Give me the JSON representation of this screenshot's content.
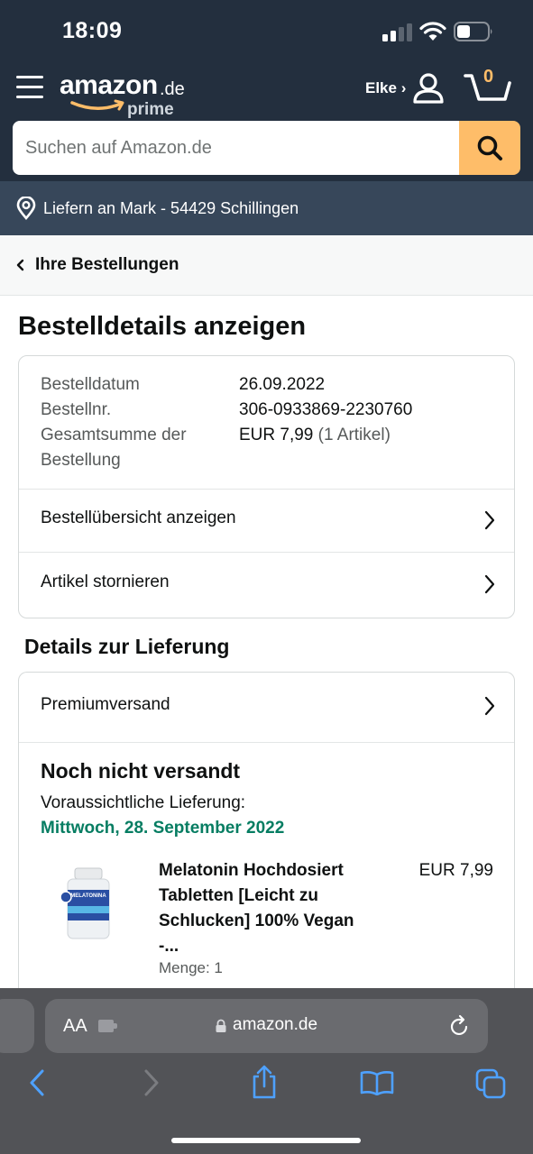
{
  "status_bar": {
    "time": "18:09"
  },
  "header": {
    "logo_word": "amazon",
    "logo_tld": ".de",
    "logo_prime": "prime",
    "account_label": "Elke ›",
    "cart_count": "0",
    "search_placeholder": "Suchen auf Amazon.de",
    "deliver_to": "Liefern an Mark - 54429 Schillingen"
  },
  "breadcrumb": {
    "label": "Ihre Bestellungen"
  },
  "page_title": "Bestelldetails anzeigen",
  "order": {
    "date_label": "Bestelldatum",
    "date_value": "26.09.2022",
    "number_label": "Bestellnr.",
    "number_value": "306-0933869-2230760",
    "total_label_1": "Gesamtsumme der",
    "total_label_2": "Bestellung",
    "total_value": "EUR 7,99",
    "total_items": "(1 Artikel)",
    "summary_link": "Bestellübersicht anzeigen",
    "cancel_link": "Artikel stornieren"
  },
  "delivery": {
    "section_title": "Details zur Lieferung",
    "shipping_method": "Premiumversand",
    "status": "Noch nicht versandt",
    "eta_label": "Voraussichtliche Lieferung:",
    "eta_date": "Mittwoch, 28. September 2022",
    "item": {
      "title_lines": [
        "Melatonin Hochdosiert",
        "Tabletten [Leicht zu",
        "Schlucken] 100% Vegan",
        "-..."
      ],
      "price": "EUR 7,99",
      "quantity": "Menge: 1",
      "image_label": "MELATONINA"
    }
  },
  "browser": {
    "text_size_label": "AA",
    "domain": "amazon.de"
  },
  "colors": {
    "header_bg": "#232f3e",
    "deliver_bg": "#37475a",
    "search_button": "#febd69",
    "eta_green": "#067d62",
    "safari_bar": "#525357"
  }
}
